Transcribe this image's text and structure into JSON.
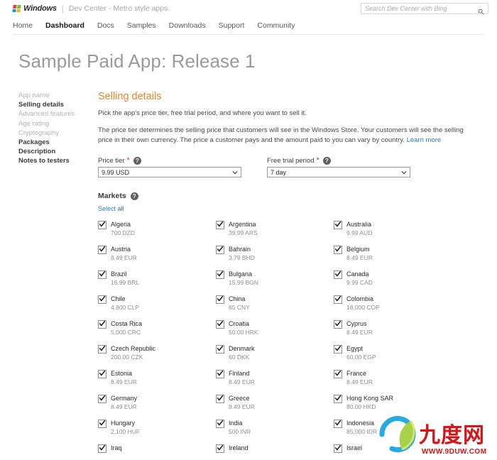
{
  "header": {
    "brand_name": "Windows",
    "separator": "|",
    "brand_sub": "Dev Center - Metro style apps",
    "search_placeholder": "Search Dev Center with Bing"
  },
  "nav": {
    "items": [
      {
        "label": "Home",
        "active": false
      },
      {
        "label": "Dashboard",
        "active": true
      },
      {
        "label": "Docs",
        "active": false
      },
      {
        "label": "Samples",
        "active": false
      },
      {
        "label": "Downloads",
        "active": false
      },
      {
        "label": "Support",
        "active": false
      },
      {
        "label": "Community",
        "active": false
      }
    ]
  },
  "page": {
    "title": "Sample Paid App: Release 1"
  },
  "sidebar": {
    "items": [
      {
        "label": "App name",
        "strong": false
      },
      {
        "label": "Selling details",
        "strong": true
      },
      {
        "label": "Advanced features",
        "strong": false
      },
      {
        "label": "Age rating",
        "strong": false
      },
      {
        "label": "Cryptography",
        "strong": false
      },
      {
        "label": "Packages",
        "strong": true
      },
      {
        "label": "Description",
        "strong": true
      },
      {
        "label": "Notes to testers",
        "strong": true
      }
    ]
  },
  "main": {
    "section_title": "Selling details",
    "lead": "Pick the app's price tier, free trial period, and where you want to sell it.",
    "paragraph": "The price tier determines the selling price that customers will see in the Windows Store. Your customers will see the selling price in their own currency. The price a customer pays and the amount paid to you can vary by country.",
    "learn_more": "Learn more",
    "price_tier": {
      "label": "Price tier",
      "required_mark": "*",
      "help": "?",
      "value": "9.99 USD"
    },
    "free_trial": {
      "label": "Free trial period",
      "required_mark": "*",
      "help": "?",
      "value": "7 day"
    },
    "markets": {
      "label": "Markets",
      "help": "?",
      "select_all": "Select all",
      "countries": [
        {
          "name": "Algeria",
          "price": "700 DZD",
          "checked": true
        },
        {
          "name": "Argentina",
          "price": "39.99 ARS",
          "checked": true
        },
        {
          "name": "Australia",
          "price": "9.99 AUD",
          "checked": true
        },
        {
          "name": "Austria",
          "price": "8.49 EUR",
          "checked": true
        },
        {
          "name": "Bahrain",
          "price": "3.79 BHD",
          "checked": true
        },
        {
          "name": "Belgium",
          "price": "8.49 EUR",
          "checked": true
        },
        {
          "name": "Brazil",
          "price": "16.99 BRL",
          "checked": true
        },
        {
          "name": "Bulgaria",
          "price": "15.99 BGN",
          "checked": true
        },
        {
          "name": "Canada",
          "price": "9.99 CAD",
          "checked": true
        },
        {
          "name": "Chile",
          "price": "4,800 CLP",
          "checked": true
        },
        {
          "name": "China",
          "price": "65 CNY",
          "checked": true
        },
        {
          "name": "Colombia",
          "price": "18,000 COP",
          "checked": true
        },
        {
          "name": "Costa Rica",
          "price": "5,000 CRC",
          "checked": true
        },
        {
          "name": "Croatia",
          "price": "50.00 HRK",
          "checked": true
        },
        {
          "name": "Cyprus",
          "price": "8.49 EUR",
          "checked": true
        },
        {
          "name": "Czech Republic",
          "price": "200.00 CZK",
          "checked": true
        },
        {
          "name": "Denmark",
          "price": "60 DKK",
          "checked": true
        },
        {
          "name": "Egypt",
          "price": "60.00 EGP",
          "checked": true
        },
        {
          "name": "Estonia",
          "price": "8.49 EUR",
          "checked": true
        },
        {
          "name": "Finland",
          "price": "8.49 EUR",
          "checked": true
        },
        {
          "name": "France",
          "price": "8.49 EUR",
          "checked": true
        },
        {
          "name": "Germany",
          "price": "8.49 EUR",
          "checked": true
        },
        {
          "name": "Greece",
          "price": "8.49 EUR",
          "checked": true
        },
        {
          "name": "Hong Kong SAR",
          "price": "80.00 HKD",
          "checked": true
        },
        {
          "name": "Hungary",
          "price": "2,100 HUF",
          "checked": true
        },
        {
          "name": "India",
          "price": "500 INR",
          "checked": true
        },
        {
          "name": "Indonesia",
          "price": "85,000 IDR",
          "checked": true
        },
        {
          "name": "Iraq",
          "price": "",
          "checked": true
        },
        {
          "name": "Ireland",
          "price": "",
          "checked": true
        },
        {
          "name": "Israel",
          "price": "",
          "checked": true
        }
      ]
    }
  },
  "watermark": {
    "text": "九度网",
    "url": "WWW.9DUW.COM"
  }
}
